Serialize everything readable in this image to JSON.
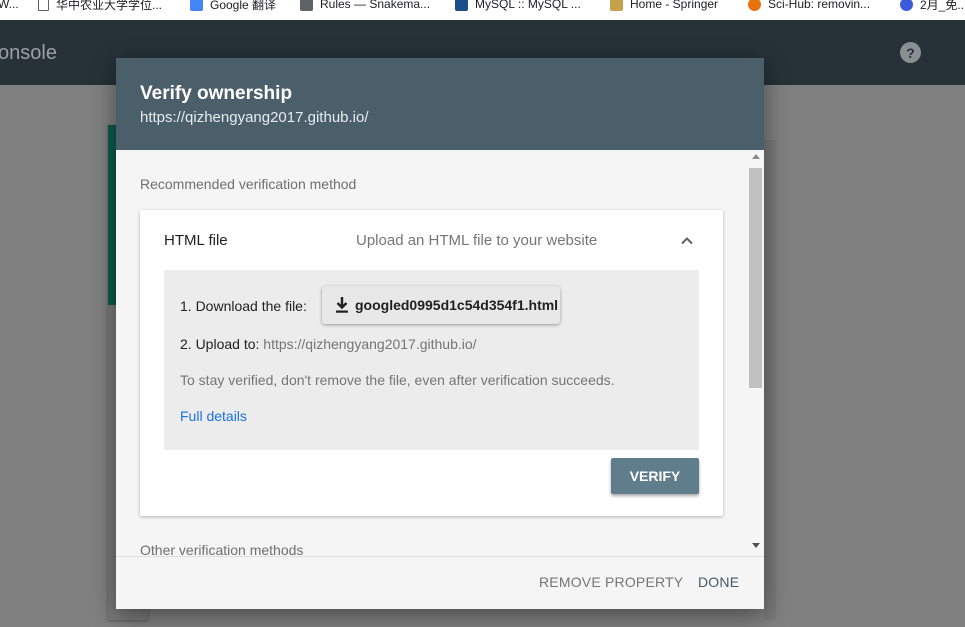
{
  "bookmarks": [
    {
      "label": "W...",
      "icon": "blank-icon",
      "color": "#ffffff"
    },
    {
      "label": "华中农业大学学位...",
      "icon": "page-icon",
      "color": "#ffffff"
    },
    {
      "label": "Google 翻译",
      "icon": "google-translate-icon",
      "color": "#4285f4"
    },
    {
      "label": "Rules — Snakema...",
      "icon": "doc-icon",
      "color": "#5f6368"
    },
    {
      "label": "MySQL :: MySQL ...",
      "icon": "mysql-icon",
      "color": "#1a4f8a"
    },
    {
      "label": "Home - Springer",
      "icon": "springer-icon",
      "color": "#c8a24a"
    },
    {
      "label": "Sci-Hub: removin...",
      "icon": "scihub-icon",
      "color": "#e8710a"
    },
    {
      "label": "2月_免...",
      "icon": "link-icon",
      "color": "#3b5bdb"
    }
  ],
  "app": {
    "title": "onsole",
    "help": "?"
  },
  "dialog": {
    "title": "Verify ownership",
    "subtitle": "https://qizhengyang2017.github.io/",
    "recommended_label": "Recommended verification method",
    "method": {
      "name": "HTML file",
      "description": "Upload an HTML file to your website",
      "step1_label": "1. Download the file:",
      "download_filename": "googled0995d1c54d354f1.html",
      "step2_label": "2. Upload to:",
      "step2_url": "https://qizhengyang2017.github.io/",
      "note": "To stay verified, don't remove the file, even after verification succeeds.",
      "details_link": "Full details",
      "verify_label": "VERIFY"
    },
    "other_label": "Other verification methods",
    "footer": {
      "remove_label": "REMOVE PROPERTY",
      "done_label": "DONE"
    }
  },
  "colors": {
    "header": "#4b5f6b",
    "verify_button": "#607d8b",
    "link": "#1a73e8"
  }
}
